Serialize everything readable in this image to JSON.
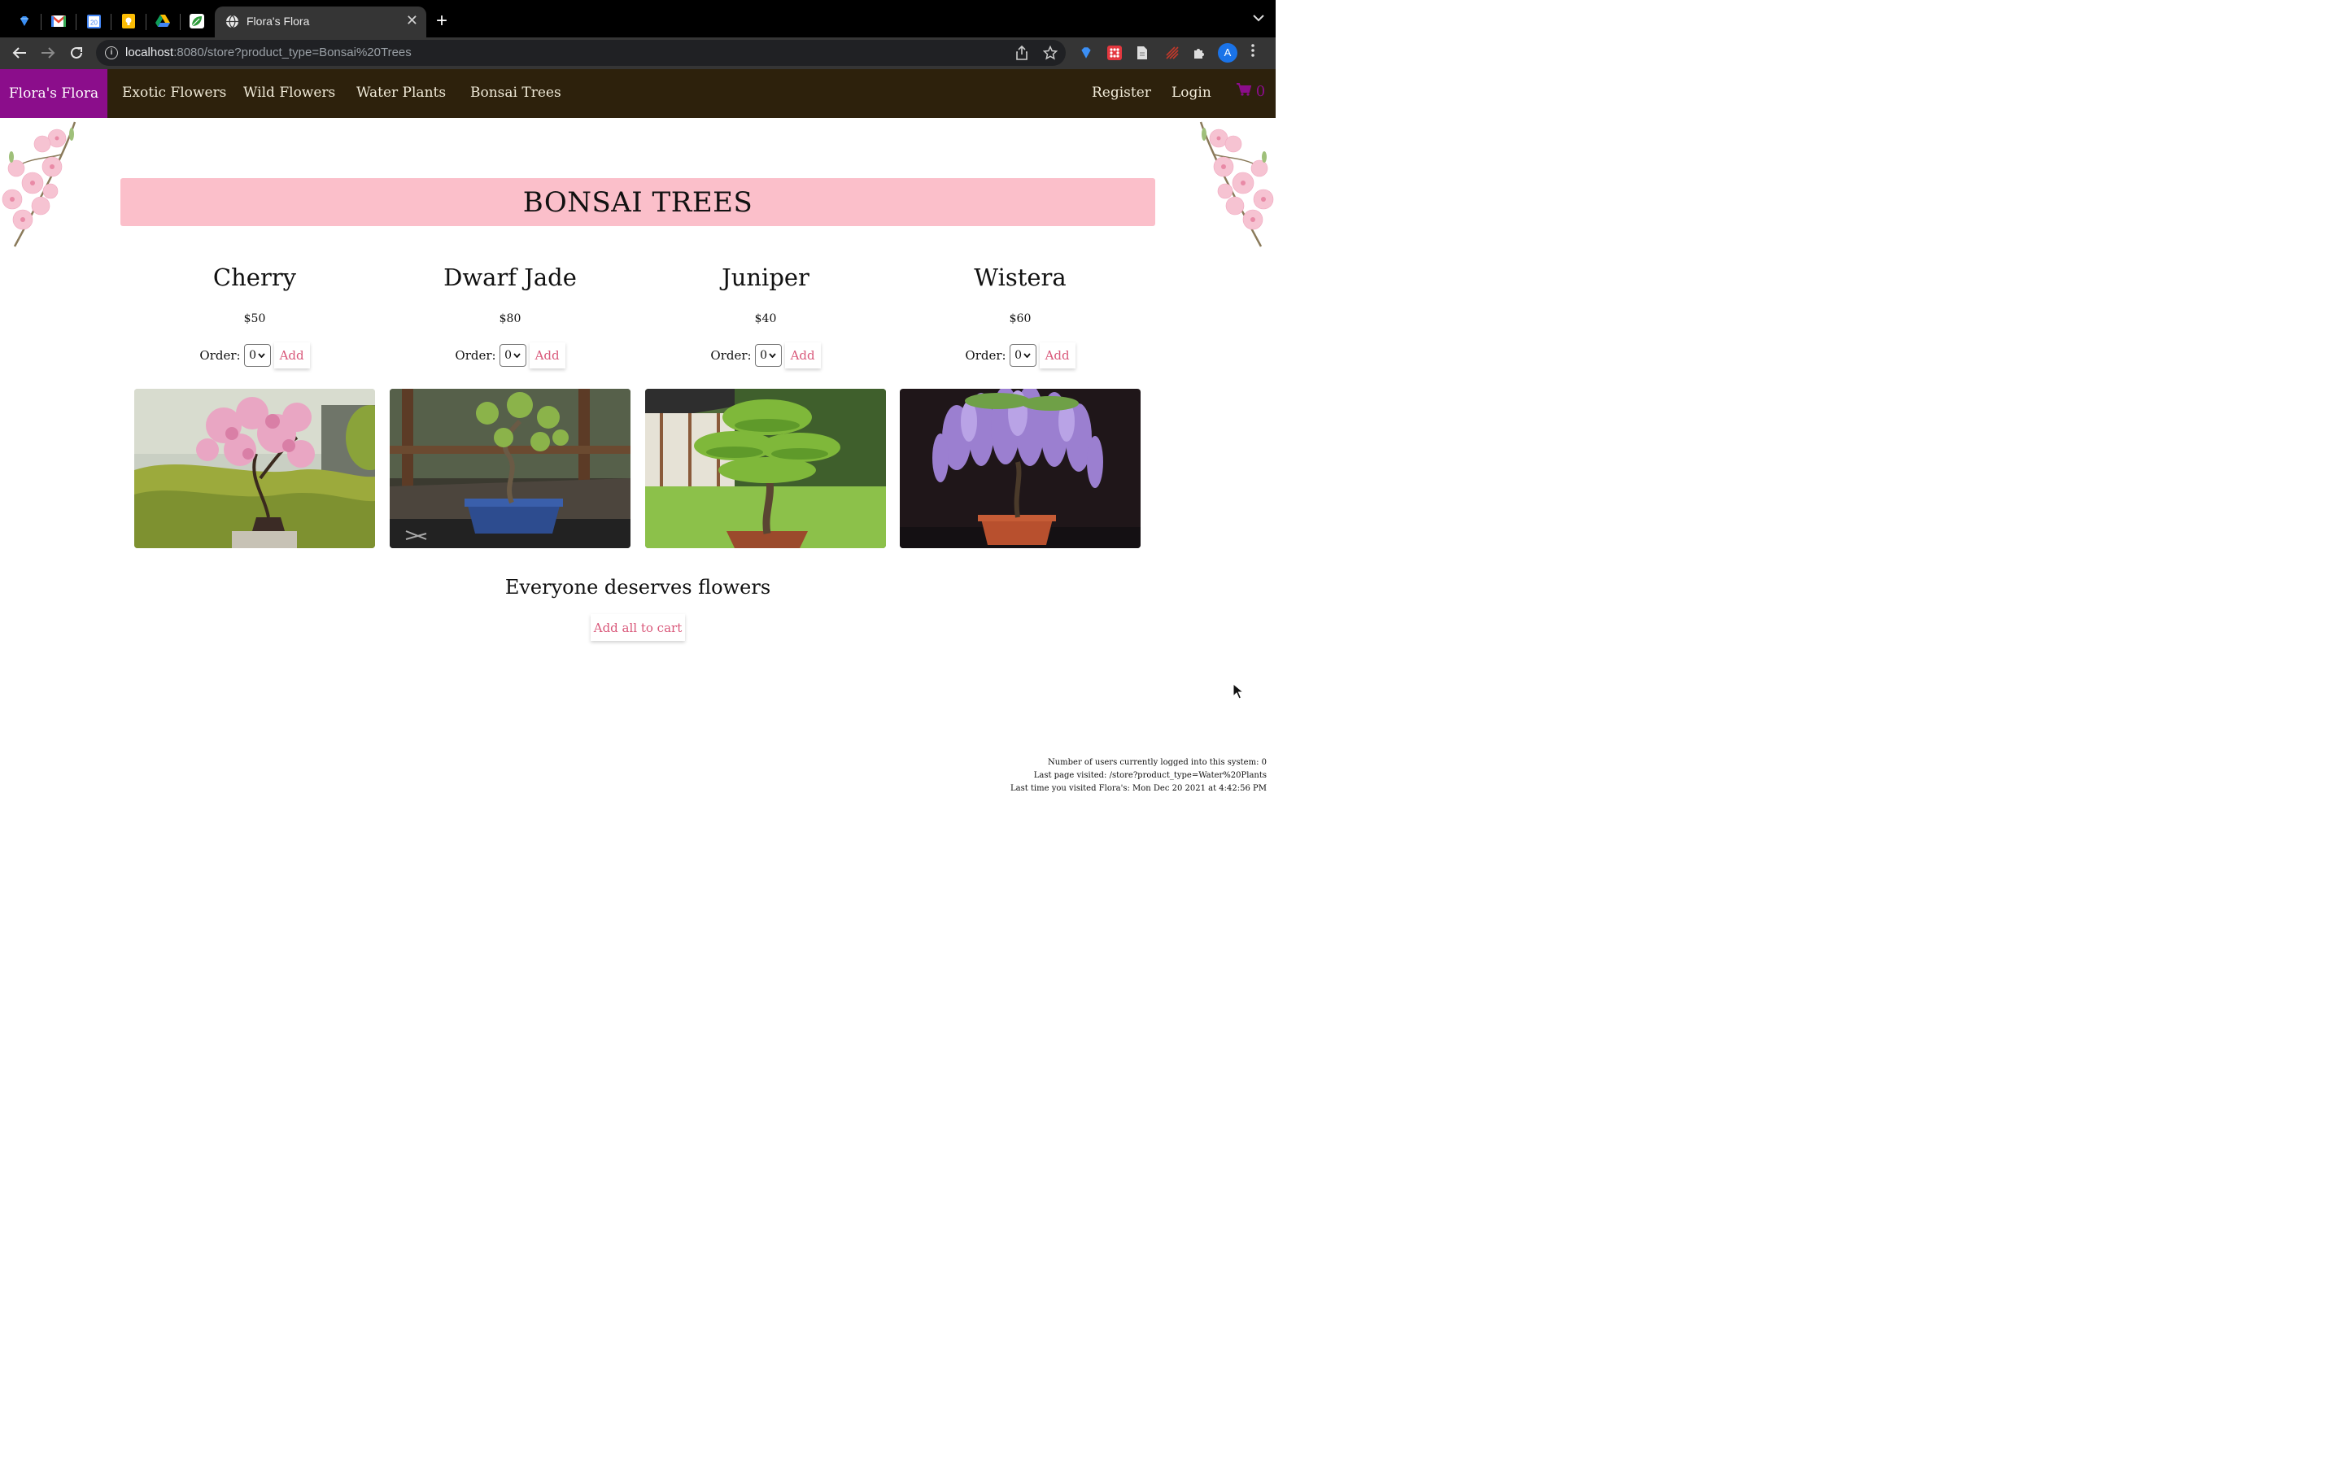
{
  "browser": {
    "pinned_tabs": [
      {
        "icon": "diamond-icon"
      },
      {
        "icon": "gmail-icon"
      },
      {
        "icon": "calendar-icon",
        "text": "20"
      },
      {
        "icon": "keep-icon"
      },
      {
        "icon": "drive-icon"
      },
      {
        "icon": "leaf-icon"
      }
    ],
    "active_tab_title": "Flora's Flora",
    "url_host": "localhost",
    "url_rest": ":8080/store?product_type=Bonsai%20Trees",
    "profile_initial": "A"
  },
  "site": {
    "brand": "Flora's Flora",
    "nav_links": [
      "Exotic Flowers",
      "Wild Flowers",
      "Water Plants",
      "Bonsai Trees"
    ],
    "register": "Register",
    "login": "Login",
    "cart_count": "0",
    "colors": {
      "brand": "#8b0d8b",
      "nav_bg": "#2d210c",
      "banner": "#fbbfca",
      "button_text": "#d9587a"
    }
  },
  "page": {
    "heading": "BONSAI TREES",
    "order_label": "Order:",
    "add_label": "Add",
    "products": [
      {
        "name": "Cherry",
        "price": "$50",
        "qty": "0",
        "image": "cherry-bonsai-photo"
      },
      {
        "name": "Dwarf Jade",
        "price": "$80",
        "qty": "0",
        "image": "dwarf-jade-bonsai-photo"
      },
      {
        "name": "Juniper",
        "price": "$40",
        "qty": "0",
        "image": "juniper-bonsai-photo"
      },
      {
        "name": "Wistera",
        "price": "$60",
        "qty": "0",
        "image": "wisteria-bonsai-photo"
      }
    ],
    "tagline": "Everyone deserves flowers",
    "add_all": "Add all to cart"
  },
  "footer": {
    "users_logged_in": "Number of users currently logged into this system: 0",
    "last_page": "Last page visited: /store?product_type=Water%20Plants",
    "last_visit": "Last time you visited Flora's: Mon Dec 20 2021 at 4:42:56 PM"
  }
}
